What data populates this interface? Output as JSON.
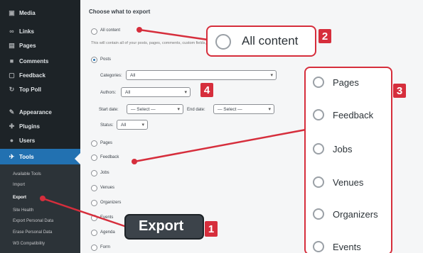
{
  "sidebar": {
    "items": [
      {
        "label": "Media",
        "icon": "media-icon"
      },
      {
        "label": "Links",
        "icon": "link-icon"
      },
      {
        "label": "Pages",
        "icon": "page-icon"
      },
      {
        "label": "Comments",
        "icon": "comment-icon"
      },
      {
        "label": "Feedback",
        "icon": "feedback-icon"
      },
      {
        "label": "Top Poll",
        "icon": "poll-icon"
      },
      {
        "label": "Appearance",
        "icon": "brush-icon"
      },
      {
        "label": "Plugins",
        "icon": "plugin-icon"
      },
      {
        "label": "Users",
        "icon": "user-icon"
      },
      {
        "label": "Tools",
        "icon": "wrench-icon"
      }
    ],
    "submenu": [
      "Available Tools",
      "Import",
      "Export",
      "Site Health",
      "Export Personal Data",
      "Erase Personal Data",
      "W3 Compatibility"
    ]
  },
  "main": {
    "heading": "Choose what to export",
    "all_content": "All content",
    "all_content_desc": "This will contain all of your posts, pages, comments, custom fields, terms, navigation menus, and custom posts.",
    "posts": "Posts",
    "categories_label": "Categories:",
    "categories_value": "All",
    "authors_label": "Authors:",
    "authors_value": "All",
    "start_date_label": "Start date:",
    "start_date_value": "— Select —",
    "end_date_label": "End date:",
    "end_date_value": "— Select —",
    "status_label": "Status:",
    "status_value": "All",
    "post_types": [
      "Pages",
      "Feedback",
      "Jobs",
      "Venues",
      "Organizers",
      "Events",
      "Agenda",
      "Form"
    ]
  },
  "callouts": {
    "all_content": "All content",
    "types": [
      "Pages",
      "Feedback",
      "Jobs",
      "Venues",
      "Organizers",
      "Events"
    ],
    "export": "Export",
    "badges": [
      "1",
      "2",
      "3",
      "4"
    ]
  },
  "colors": {
    "accent": "#d62e3c",
    "wp_blue": "#2271b1",
    "sidebar": "#1d2327"
  }
}
